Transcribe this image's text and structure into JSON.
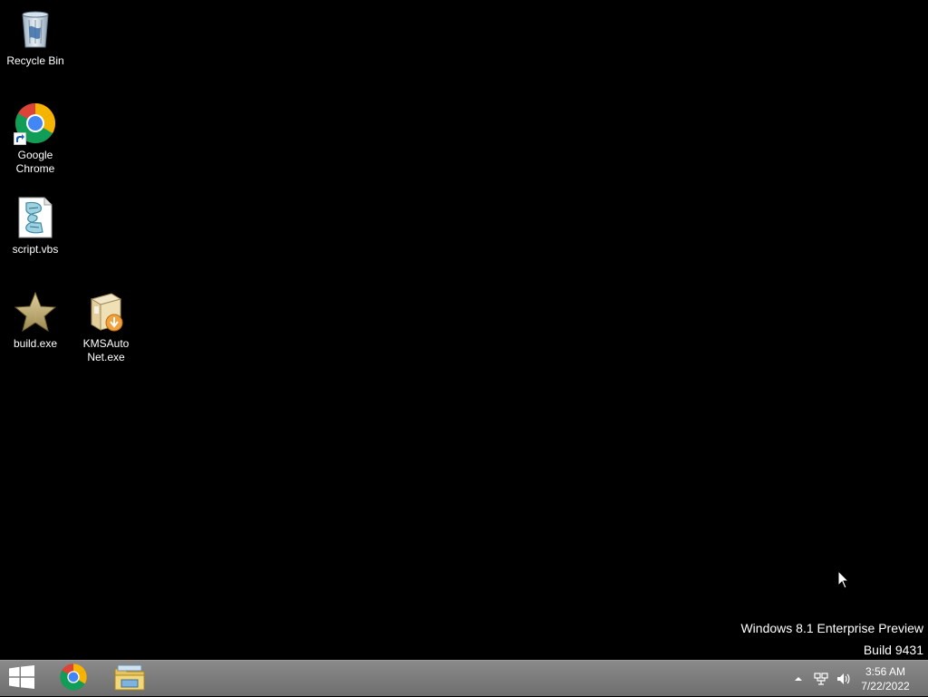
{
  "desktop": {
    "icons": [
      {
        "label": "Recycle Bin",
        "icon": "recycle-bin-icon"
      },
      {
        "label": "Google Chrome",
        "icon": "chrome-icon"
      },
      {
        "label": "script.vbs",
        "icon": "vbs-script-icon"
      },
      {
        "label": "build.exe",
        "icon": "star-exe-icon"
      },
      {
        "label": "KMSAuto Net.exe",
        "icon": "installer-box-icon"
      }
    ],
    "watermark": {
      "line1": "Windows 8.1 Enterprise Preview",
      "line2": "Build 9431"
    }
  },
  "taskbar": {
    "start": "windows-start-icon",
    "pinned": [
      "chrome-icon",
      "file-explorer-icon"
    ],
    "tray": {
      "icons": [
        "show-hidden-icons-arrow",
        "network-icon",
        "volume-icon"
      ],
      "time": "3:56 AM",
      "date": "7/22/2022"
    }
  },
  "colors": {
    "desktop_background": "#000000",
    "taskbar": "#7a7a7a",
    "text": "#ffffff"
  }
}
